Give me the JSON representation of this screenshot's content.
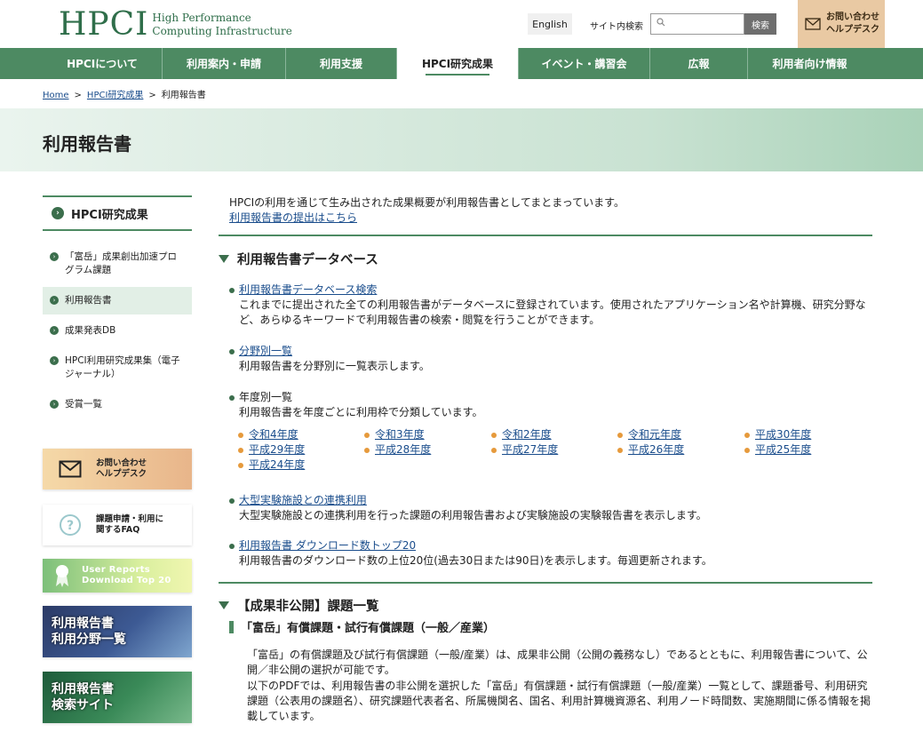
{
  "header": {
    "logo_mark": "HPCI",
    "logo_line1": "High Performance",
    "logo_line2": "Computing Infrastructure",
    "lang_label": "English",
    "search_label": "サイト内検索",
    "search_placeholder": "",
    "search_button": "検索",
    "help_label": "お問い合わせ\nヘルプデスク"
  },
  "nav": {
    "items": [
      {
        "label": "HPCIについて"
      },
      {
        "label": "利用案内・申請"
      },
      {
        "label": "利用支援"
      },
      {
        "label": "HPCI研究成果"
      },
      {
        "label": "イベント・講習会"
      },
      {
        "label": "広報"
      },
      {
        "label": "利用者向け情報"
      }
    ],
    "active_index": 3
  },
  "breadcrumb": {
    "home": "Home",
    "parent": "HPCI研究成果",
    "current": "利用報告書",
    "sep": ">"
  },
  "page_title": "利用報告書",
  "sidebar": {
    "heading": "HPCI研究成果",
    "items": [
      {
        "label": "「富岳」成果創出加速プログラム課題"
      },
      {
        "label": "利用報告書"
      },
      {
        "label": "成果発表DB"
      },
      {
        "label": "HPCI利用研究成果集（電子ジャーナル）"
      },
      {
        "label": "受賞一覧"
      }
    ],
    "banners": {
      "help": "お問い合わせ\nヘルプデスク",
      "faq": "課題申請・利用に\n関するFAQ",
      "top20": "User Reports\nDownload Top 20",
      "field": "利用報告書\n利用分野一覧",
      "search": "利用報告書\n検索サイト"
    }
  },
  "main": {
    "intro_text": "HPCIの利用を通じて生み出された成果概要が利用報告書としてまとまっています。",
    "intro_link": "利用報告書の提出はこちら",
    "section1_title": "利用報告書データベース",
    "db_link": "利用報告書データベース検索",
    "db_desc": "これまでに提出された全ての利用報告書がデータベースに登録されています。使用されたアプリケーション名や計算機、研究分野など、あらゆるキーワードで利用報告書の検索・閲覧を行うことができます。",
    "field_link": "分野別一覧",
    "field_desc": "利用報告書を分野別に一覧表示します。",
    "year_title": "年度別一覧",
    "year_desc": "利用報告書を年度ごとに利用枠で分類しています。",
    "years": [
      "令和4年度",
      "令和3年度",
      "令和2年度",
      "令和元年度",
      "平成30年度",
      "平成29年度",
      "平成28年度",
      "平成27年度",
      "平成26年度",
      "平成25年度",
      "平成24年度"
    ],
    "large_link": "大型実験施設との連携利用",
    "large_desc": "大型実験施設との連携利用を行った課題の利用報告書および実験施設の実験報告書を表示します。",
    "top20_link": "利用報告書 ダウンロード数トップ20",
    "top20_desc": "利用報告書のダウンロード数の上位20位(過去30日または90日)を表示します。毎週更新されます。",
    "section2_title": "【成果非公開】課題一覧",
    "sub_title": "「富岳」有償課題・試行有償課題（一般／産業）",
    "para1": "「富岳」の有償課題及び試行有償課題（一般/産業）は、成果非公開（公開の義務なし）であるとともに、利用報告書について、公開／非公開の選択が可能です。",
    "para2": "以下のPDFでは、利用報告書の非公開を選択した「富岳」有償課題・試行有償課題（一般/産業）一覧として、課題番号、利用研究課題（公表用の課題名）、研究課題代表者名、所属機関名、国名、利用計算機資源名、利用ノード時間数、実施期間に係る情報を掲載しています。"
  }
}
